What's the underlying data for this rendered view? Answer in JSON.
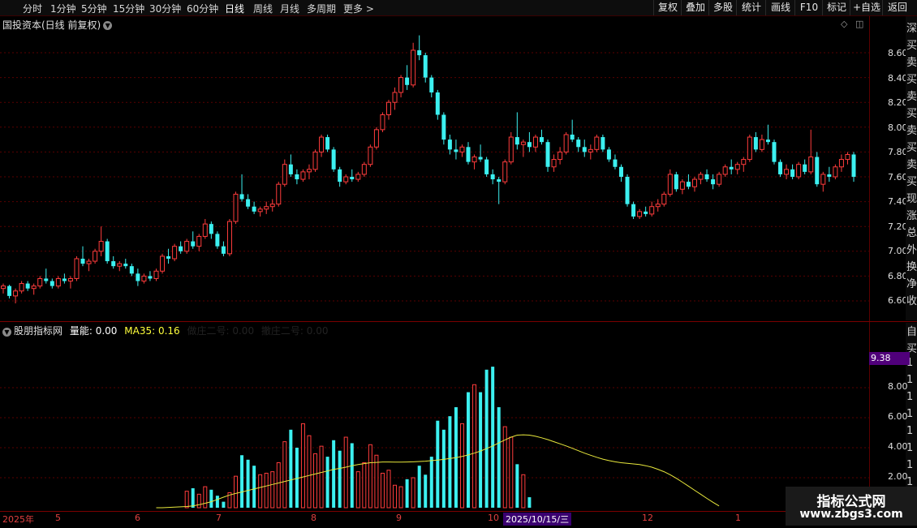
{
  "toolbar": {
    "periods": [
      "分时",
      "1分钟",
      "5分钟",
      "15分钟",
      "30分钟",
      "60分钟",
      "日线",
      "周线",
      "月线",
      "多周期",
      "更多 >"
    ],
    "active_period": "日线",
    "buttons": [
      "复权",
      "叠加",
      "多股",
      "统计",
      "画线",
      "F10",
      "标记",
      "+自选",
      "返回"
    ]
  },
  "main_chart": {
    "title": "国投资本(日线 前复权)",
    "y_ticks": [
      "8.60",
      "8.40",
      "8.20",
      "8.00",
      "7.80",
      "7.60",
      "7.40",
      "7.20",
      "7.00",
      "6.80",
      "6.60"
    ],
    "up_color": "#ff3c3c",
    "down_color": "#3cf0f0"
  },
  "indicator": {
    "name": "股朋指标网",
    "vol_label": "量能: 0.00",
    "ma_label": "MA35: 0.16",
    "extra1": "做庄二号: 0.00",
    "extra2": "撤庄二号: 0.00",
    "highlight_value": "9.38",
    "y_ticks": [
      "8.00",
      "6.00",
      "4.00",
      "2.00"
    ]
  },
  "right_strip": [
    "深",
    "买",
    "卖",
    "买",
    "卖",
    "买",
    "卖",
    "买",
    "卖",
    "买",
    "现",
    "涨",
    "总",
    "外",
    "换",
    "净",
    "收"
  ],
  "right_strip_lower": [
    "自",
    "买",
    "1",
    "1",
    "1",
    "1",
    "1",
    "1",
    "1",
    "1",
    "1"
  ],
  "x_axis": {
    "labels": [
      "2025年",
      "5",
      "6",
      "7",
      "8",
      "9",
      "10",
      "12",
      "1"
    ],
    "cursor_date": "2025/10/15/三"
  },
  "watermark": {
    "line1": "指标公式网",
    "line2": "www.zbgs3.com"
  },
  "chart_data": {
    "type": "candlestick",
    "ylim": [
      6.55,
      8.75
    ],
    "candles": [
      [
        6.7,
        6.74,
        6.66,
        6.72
      ],
      [
        6.72,
        6.73,
        6.62,
        6.64
      ],
      [
        6.64,
        6.7,
        6.58,
        6.68
      ],
      [
        6.68,
        6.76,
        6.66,
        6.74
      ],
      [
        6.74,
        6.76,
        6.68,
        6.7
      ],
      [
        6.7,
        6.74,
        6.65,
        6.72
      ],
      [
        6.72,
        6.8,
        6.7,
        6.78
      ],
      [
        6.78,
        6.86,
        6.74,
        6.76
      ],
      [
        6.76,
        6.78,
        6.7,
        6.72
      ],
      [
        6.72,
        6.8,
        6.7,
        6.78
      ],
      [
        6.78,
        6.82,
        6.74,
        6.76
      ],
      [
        6.76,
        6.8,
        6.7,
        6.78
      ],
      [
        6.78,
        6.96,
        6.76,
        6.94
      ],
      [
        6.94,
        7.04,
        6.88,
        6.9
      ],
      [
        6.9,
        6.94,
        6.84,
        6.92
      ],
      [
        6.92,
        7.02,
        6.9,
        7.0
      ],
      [
        7.0,
        7.2,
        6.96,
        7.08
      ],
      [
        7.08,
        7.1,
        6.9,
        6.92
      ],
      [
        6.92,
        6.96,
        6.86,
        6.88
      ],
      [
        6.88,
        6.92,
        6.84,
        6.9
      ],
      [
        6.9,
        6.94,
        6.86,
        6.88
      ],
      [
        6.88,
        6.9,
        6.8,
        6.82
      ],
      [
        6.82,
        6.86,
        6.72,
        6.76
      ],
      [
        6.76,
        6.82,
        6.74,
        6.8
      ],
      [
        6.8,
        6.84,
        6.76,
        6.78
      ],
      [
        6.78,
        6.86,
        6.76,
        6.84
      ],
      [
        6.84,
        6.98,
        6.82,
        6.96
      ],
      [
        6.96,
        7.02,
        6.9,
        6.94
      ],
      [
        6.94,
        7.06,
        6.92,
        7.04
      ],
      [
        7.04,
        7.08,
        6.98,
        7.0
      ],
      [
        7.0,
        7.1,
        6.98,
        7.08
      ],
      [
        7.08,
        7.16,
        7.02,
        7.04
      ],
      [
        7.04,
        7.14,
        7.0,
        7.12
      ],
      [
        7.12,
        7.26,
        7.1,
        7.22
      ],
      [
        7.22,
        7.24,
        7.1,
        7.14
      ],
      [
        7.14,
        7.16,
        7.02,
        7.04
      ],
      [
        7.04,
        7.08,
        6.96,
        6.98
      ],
      [
        6.98,
        7.26,
        6.96,
        7.24
      ],
      [
        7.24,
        7.48,
        7.22,
        7.46
      ],
      [
        7.46,
        7.62,
        7.4,
        7.42
      ],
      [
        7.42,
        7.46,
        7.34,
        7.36
      ],
      [
        7.36,
        7.4,
        7.3,
        7.32
      ],
      [
        7.32,
        7.36,
        7.28,
        7.34
      ],
      [
        7.34,
        7.4,
        7.3,
        7.36
      ],
      [
        7.36,
        7.42,
        7.32,
        7.38
      ],
      [
        7.38,
        7.56,
        7.36,
        7.54
      ],
      [
        7.54,
        7.74,
        7.52,
        7.7
      ],
      [
        7.7,
        7.78,
        7.6,
        7.62
      ],
      [
        7.62,
        7.66,
        7.54,
        7.58
      ],
      [
        7.58,
        7.66,
        7.56,
        7.64
      ],
      [
        7.64,
        7.7,
        7.58,
        7.66
      ],
      [
        7.66,
        7.82,
        7.64,
        7.8
      ],
      [
        7.8,
        7.94,
        7.76,
        7.92
      ],
      [
        7.92,
        7.94,
        7.8,
        7.82
      ],
      [
        7.82,
        7.84,
        7.64,
        7.66
      ],
      [
        7.66,
        7.68,
        7.52,
        7.56
      ],
      [
        7.56,
        7.62,
        7.54,
        7.6
      ],
      [
        7.6,
        7.66,
        7.56,
        7.58
      ],
      [
        7.58,
        7.64,
        7.56,
        7.62
      ],
      [
        7.62,
        7.72,
        7.6,
        7.7
      ],
      [
        7.7,
        7.86,
        7.68,
        7.84
      ],
      [
        7.84,
        8.0,
        7.82,
        7.98
      ],
      [
        7.98,
        8.12,
        7.96,
        8.1
      ],
      [
        8.1,
        8.22,
        8.06,
        8.2
      ],
      [
        8.2,
        8.32,
        8.14,
        8.28
      ],
      [
        8.28,
        8.42,
        8.24,
        8.4
      ],
      [
        8.4,
        8.5,
        8.3,
        8.34
      ],
      [
        8.34,
        8.68,
        8.32,
        8.62
      ],
      [
        8.62,
        8.74,
        8.54,
        8.58
      ],
      [
        8.58,
        8.6,
        8.36,
        8.4
      ],
      [
        8.4,
        8.42,
        8.24,
        8.28
      ],
      [
        8.28,
        8.3,
        8.06,
        8.1
      ],
      [
        8.1,
        8.12,
        7.86,
        7.9
      ],
      [
        7.9,
        7.94,
        7.78,
        7.82
      ],
      [
        7.82,
        7.9,
        7.74,
        7.8
      ],
      [
        7.8,
        7.86,
        7.76,
        7.84
      ],
      [
        7.84,
        7.88,
        7.7,
        7.72
      ],
      [
        7.72,
        7.78,
        7.66,
        7.76
      ],
      [
        7.76,
        7.86,
        7.72,
        7.74
      ],
      [
        7.74,
        7.76,
        7.6,
        7.62
      ],
      [
        7.62,
        7.66,
        7.54,
        7.58
      ],
      [
        7.58,
        7.6,
        7.38,
        7.56
      ],
      [
        7.56,
        7.74,
        7.54,
        7.72
      ],
      [
        7.72,
        7.96,
        7.7,
        7.92
      ],
      [
        7.92,
        8.12,
        7.82,
        7.86
      ],
      [
        7.86,
        7.9,
        7.76,
        7.88
      ],
      [
        7.88,
        7.96,
        7.8,
        7.84
      ],
      [
        7.84,
        7.94,
        7.8,
        7.92
      ],
      [
        7.92,
        7.98,
        7.86,
        7.88
      ],
      [
        7.88,
        7.9,
        7.64,
        7.68
      ],
      [
        7.68,
        7.78,
        7.64,
        7.74
      ],
      [
        7.74,
        7.84,
        7.7,
        7.8
      ],
      [
        7.8,
        7.96,
        7.78,
        7.94
      ],
      [
        7.94,
        8.06,
        7.88,
        7.9
      ],
      [
        7.9,
        7.92,
        7.8,
        7.84
      ],
      [
        7.84,
        7.9,
        7.76,
        7.8
      ],
      [
        7.8,
        7.86,
        7.74,
        7.82
      ],
      [
        7.82,
        7.94,
        7.8,
        7.92
      ],
      [
        7.92,
        7.94,
        7.8,
        7.82
      ],
      [
        7.82,
        7.84,
        7.72,
        7.74
      ],
      [
        7.74,
        7.78,
        7.66,
        7.68
      ],
      [
        7.68,
        7.7,
        7.56,
        7.6
      ],
      [
        7.6,
        7.62,
        7.36,
        7.38
      ],
      [
        7.38,
        7.4,
        7.26,
        7.28
      ],
      [
        7.28,
        7.34,
        7.26,
        7.32
      ],
      [
        7.32,
        7.36,
        7.28,
        7.3
      ],
      [
        7.3,
        7.4,
        7.28,
        7.36
      ],
      [
        7.36,
        7.42,
        7.32,
        7.38
      ],
      [
        7.38,
        7.48,
        7.36,
        7.46
      ],
      [
        7.46,
        7.66,
        7.44,
        7.62
      ],
      [
        7.62,
        7.64,
        7.48,
        7.5
      ],
      [
        7.5,
        7.58,
        7.46,
        7.56
      ],
      [
        7.56,
        7.62,
        7.5,
        7.52
      ],
      [
        7.52,
        7.6,
        7.48,
        7.58
      ],
      [
        7.58,
        7.64,
        7.54,
        7.62
      ],
      [
        7.62,
        7.66,
        7.56,
        7.58
      ],
      [
        7.58,
        7.62,
        7.5,
        7.54
      ],
      [
        7.54,
        7.64,
        7.52,
        7.62
      ],
      [
        7.62,
        7.7,
        7.6,
        7.68
      ],
      [
        7.68,
        7.74,
        7.62,
        7.66
      ],
      [
        7.66,
        7.72,
        7.62,
        7.7
      ],
      [
        7.7,
        7.76,
        7.64,
        7.74
      ],
      [
        7.74,
        7.94,
        7.72,
        7.92
      ],
      [
        7.92,
        7.96,
        7.8,
        7.82
      ],
      [
        7.82,
        7.94,
        7.8,
        7.9
      ],
      [
        7.9,
        8.02,
        7.86,
        7.88
      ],
      [
        7.88,
        7.9,
        7.7,
        7.72
      ],
      [
        7.72,
        7.74,
        7.6,
        7.62
      ],
      [
        7.62,
        7.7,
        7.58,
        7.66
      ],
      [
        7.66,
        7.7,
        7.58,
        7.6
      ],
      [
        7.6,
        7.72,
        7.58,
        7.7
      ],
      [
        7.7,
        7.74,
        7.62,
        7.64
      ],
      [
        7.64,
        7.98,
        7.62,
        7.76
      ],
      [
        7.76,
        7.8,
        7.52,
        7.54
      ],
      [
        7.54,
        7.64,
        7.48,
        7.62
      ],
      [
        7.62,
        7.68,
        7.56,
        7.6
      ],
      [
        7.6,
        7.7,
        7.58,
        7.68
      ],
      [
        7.68,
        7.78,
        7.64,
        7.74
      ],
      [
        7.74,
        7.8,
        7.7,
        7.78
      ],
      [
        7.78,
        7.8,
        7.56,
        7.6
      ]
    ],
    "volume": [
      0,
      0,
      0,
      0,
      0,
      0,
      0,
      0,
      0,
      0,
      0,
      0,
      0,
      0,
      0,
      0,
      0,
      0,
      0,
      0,
      0,
      0,
      0,
      0,
      0,
      0,
      0,
      0,
      0,
      0,
      1.1,
      1.3,
      0.9,
      1.4,
      1.2,
      0.8,
      0.4,
      1.0,
      2.1,
      3.5,
      3.2,
      2.8,
      2.2,
      2.3,
      2.4,
      3.0,
      4.4,
      5.2,
      4.0,
      5.6,
      4.8,
      3.6,
      4.1,
      3.4,
      4.5,
      3.8,
      4.7,
      4.3,
      2.4,
      3.0,
      4.2,
      3.5,
      2.3,
      2.5,
      1.5,
      1.4,
      1.9,
      2.0,
      2.8,
      2.2,
      3.4,
      5.8,
      5.2,
      6.1,
      6.7,
      5.6,
      7.7,
      8.2,
      7.7,
      9.2,
      9.4,
      6.7,
      5.4,
      4.7,
      2.9,
      2.2,
      0.7,
      0,
      0,
      0,
      0,
      0,
      0,
      0,
      0,
      0,
      0,
      0,
      0,
      0,
      0,
      0,
      0,
      0,
      0,
      0,
      0,
      0,
      0,
      0,
      0,
      0,
      0,
      0,
      0,
      0,
      0,
      0,
      0,
      0,
      0,
      0,
      0,
      0,
      0,
      0,
      0,
      0,
      0,
      0,
      0,
      0,
      0,
      0,
      0,
      0,
      1.2,
      1.0,
      0.9,
      1.1,
      0,
      0,
      0,
      0,
      0,
      0,
      0,
      0,
      0,
      0
    ],
    "ma35": [
      0.0,
      0.0,
      0.02,
      0.04,
      0.06,
      0.08,
      0.12,
      0.2,
      0.3,
      0.4,
      0.55,
      0.7,
      0.85,
      0.95,
      1.05,
      1.15,
      1.25,
      1.35,
      1.45,
      1.55,
      1.65,
      1.75,
      1.85,
      1.95,
      2.05,
      2.15,
      2.25,
      2.35,
      2.45,
      2.55,
      2.62,
      2.7,
      2.8,
      2.88,
      2.94,
      3.0,
      3.02,
      3.05,
      3.05,
      3.04,
      3.04,
      3.05,
      3.06,
      3.08,
      3.1,
      3.14,
      3.18,
      3.22,
      3.28,
      3.34,
      3.42,
      3.52,
      3.64,
      3.78,
      3.94,
      4.12,
      4.32,
      4.52,
      4.7,
      4.84,
      4.86,
      4.84,
      4.76,
      4.66,
      4.54,
      4.4,
      4.26,
      4.12,
      3.96,
      3.8,
      3.64,
      3.5,
      3.36,
      3.24,
      3.14,
      3.06,
      3.0,
      2.96,
      2.92,
      2.88,
      2.8,
      2.7,
      2.56,
      2.4,
      2.2,
      1.96,
      1.7,
      1.44,
      1.16,
      0.9,
      0.62,
      0.36,
      0.12
    ],
    "vol_ylim": [
      0,
      10.8
    ]
  }
}
